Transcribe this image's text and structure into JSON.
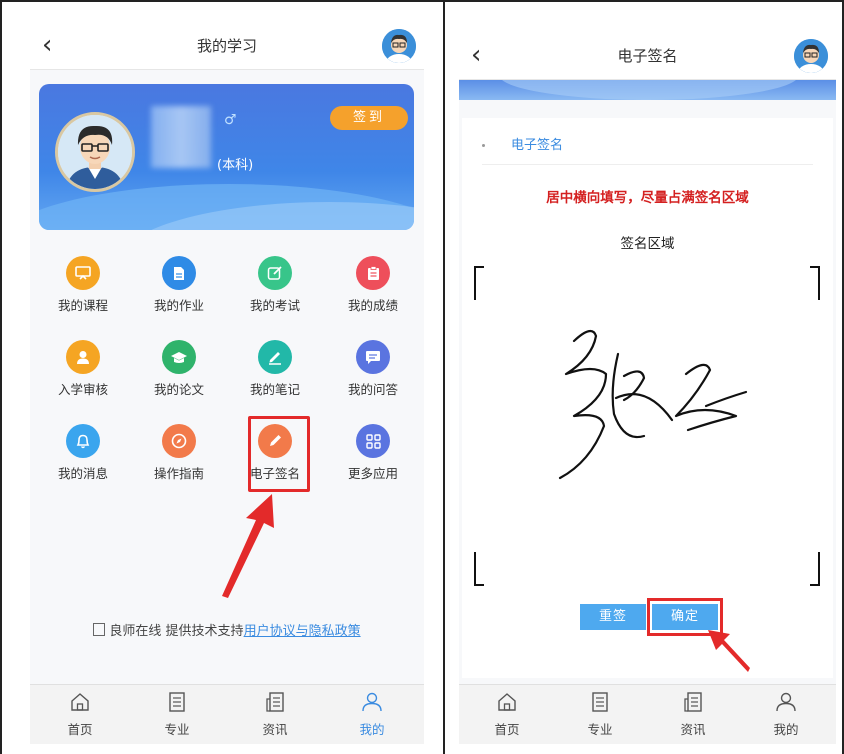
{
  "left": {
    "title": "我的学习",
    "profile": {
      "degree": "(本科)",
      "gender_symbol": "♂",
      "checkin_label": "签到"
    },
    "grid": [
      {
        "label": "我的课程",
        "icon": "screen-icon",
        "color": "#f5a523"
      },
      {
        "label": "我的作业",
        "icon": "document-icon",
        "color": "#2f8be6"
      },
      {
        "label": "我的考试",
        "icon": "edit-icon",
        "color": "#38c58a"
      },
      {
        "label": "我的成绩",
        "icon": "clipboard-icon",
        "color": "#ee4f5b"
      },
      {
        "label": "入学审核",
        "icon": "person-icon",
        "color": "#f5a523"
      },
      {
        "label": "我的论文",
        "icon": "graduation-cap-icon",
        "color": "#2fb36b"
      },
      {
        "label": "我的笔记",
        "icon": "pen-icon",
        "color": "#22b8a8"
      },
      {
        "label": "我的问答",
        "icon": "chat-icon",
        "color": "#5a74e0"
      },
      {
        "label": "我的消息",
        "icon": "bell-icon",
        "color": "#3aa5ee"
      },
      {
        "label": "操作指南",
        "icon": "compass-icon",
        "color": "#f27a4a"
      },
      {
        "label": "电子签名",
        "icon": "pencil-icon",
        "color": "#f27a4a"
      },
      {
        "label": "更多应用",
        "icon": "apps-grid-icon",
        "color": "#5a74e0"
      }
    ],
    "footer": {
      "prefix": "良师在线 提供技术支持",
      "link": "用户协议与隐私政策"
    },
    "tabs": [
      {
        "label": "首页",
        "icon": "home-icon"
      },
      {
        "label": "专业",
        "icon": "list-icon"
      },
      {
        "label": "资讯",
        "icon": "news-icon"
      },
      {
        "label": "我的",
        "icon": "user-icon",
        "active": true
      }
    ]
  },
  "right": {
    "title": "电子签名",
    "section": "电子签名",
    "warning": "居中横向填写，尽量占满签名区域",
    "area_title": "签名区域",
    "redo_label": "重签",
    "confirm_label": "确定",
    "tabs": [
      {
        "label": "首页",
        "icon": "home-icon"
      },
      {
        "label": "专业",
        "icon": "list-icon"
      },
      {
        "label": "资讯",
        "icon": "news-icon"
      },
      {
        "label": "我的",
        "icon": "user-icon"
      }
    ]
  }
}
